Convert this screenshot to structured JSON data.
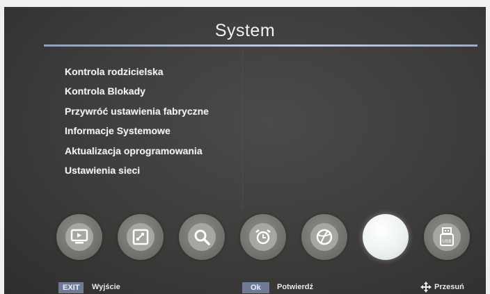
{
  "header": {
    "title": "System"
  },
  "menu": {
    "items": [
      "Kontrola rodzicielska",
      "Kontrola Blokady",
      "Przywróć ustawienia fabryczne",
      "Informacje Systemowe",
      "Aktualizacja oprogramowania",
      "Ustawienia sieci"
    ]
  },
  "icon_bar": {
    "items": [
      {
        "name": "tv-icon",
        "selected": false
      },
      {
        "name": "picture-icon",
        "selected": false
      },
      {
        "name": "search-icon",
        "selected": false
      },
      {
        "name": "alarm-clock-icon",
        "selected": false
      },
      {
        "name": "ball-icon",
        "selected": false
      },
      {
        "name": "system-icon",
        "selected": true
      },
      {
        "name": "usb-icon",
        "selected": false
      }
    ]
  },
  "footer": {
    "exit_key": "EXIT",
    "exit_label": "Wyjście",
    "ok_key": "Ok",
    "ok_label": "Potwierdź",
    "move_label": "Przesuń"
  },
  "colors": {
    "accent_line": "#c4cde6",
    "key_bg": "#6f7a94",
    "selected_icon": "#ffffff"
  }
}
